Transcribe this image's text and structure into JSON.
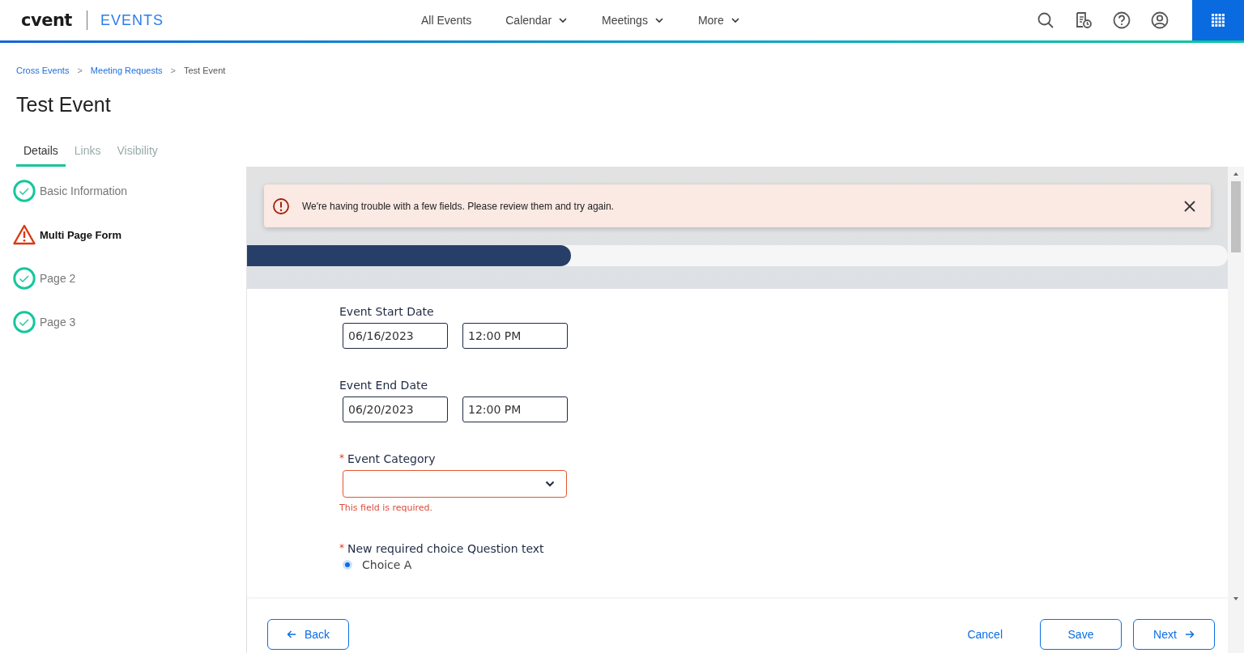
{
  "header": {
    "logo": "cvent",
    "product": "EVENTS",
    "nav": [
      {
        "label": "All Events",
        "dropdown": false
      },
      {
        "label": "Calendar",
        "dropdown": true
      },
      {
        "label": "Meetings",
        "dropdown": true
      },
      {
        "label": "More",
        "dropdown": true
      }
    ]
  },
  "breadcrumbs": [
    {
      "label": "Cross Events",
      "link": true
    },
    {
      "label": "Meeting Requests",
      "link": true
    },
    {
      "label": "Test Event",
      "link": false
    }
  ],
  "breadcrumb_separator": ">",
  "page_title": "Test Event",
  "tabs": [
    {
      "label": "Details",
      "selected": true
    },
    {
      "label": "Links",
      "selected": false
    },
    {
      "label": "Visibility",
      "selected": false
    }
  ],
  "steps": [
    {
      "label": "Basic Information",
      "kind": "complete",
      "selected": false
    },
    {
      "label": "Multi Page Form",
      "kind": "error",
      "selected": true
    },
    {
      "label": "Page 2",
      "kind": "complete",
      "selected": false
    },
    {
      "label": "Page 3",
      "kind": "complete",
      "selected": false
    }
  ],
  "alert": {
    "message": "We're having trouble with a few fields. Please review them and try again."
  },
  "progress": {
    "level": 0.33
  },
  "fields": [
    {
      "kind": "datetime",
      "label": "Event Start Date",
      "required": false,
      "date": "06/16/2023",
      "time": "12:00 PM"
    },
    {
      "kind": "datetime",
      "label": "Event End Date",
      "required": false,
      "date": "06/20/2023",
      "time": "12:00 PM"
    },
    {
      "kind": "select",
      "label": "Event Category",
      "required": true,
      "error": "This field is required."
    },
    {
      "kind": "choice",
      "label": "New required choice Question text",
      "required": true,
      "options": [
        {
          "label": "Choice A",
          "selected": true
        }
      ]
    }
  ],
  "required_mark": "*",
  "footer": {
    "back": "Back",
    "cancel": "Cancel",
    "save": "Save",
    "next": "Next"
  }
}
